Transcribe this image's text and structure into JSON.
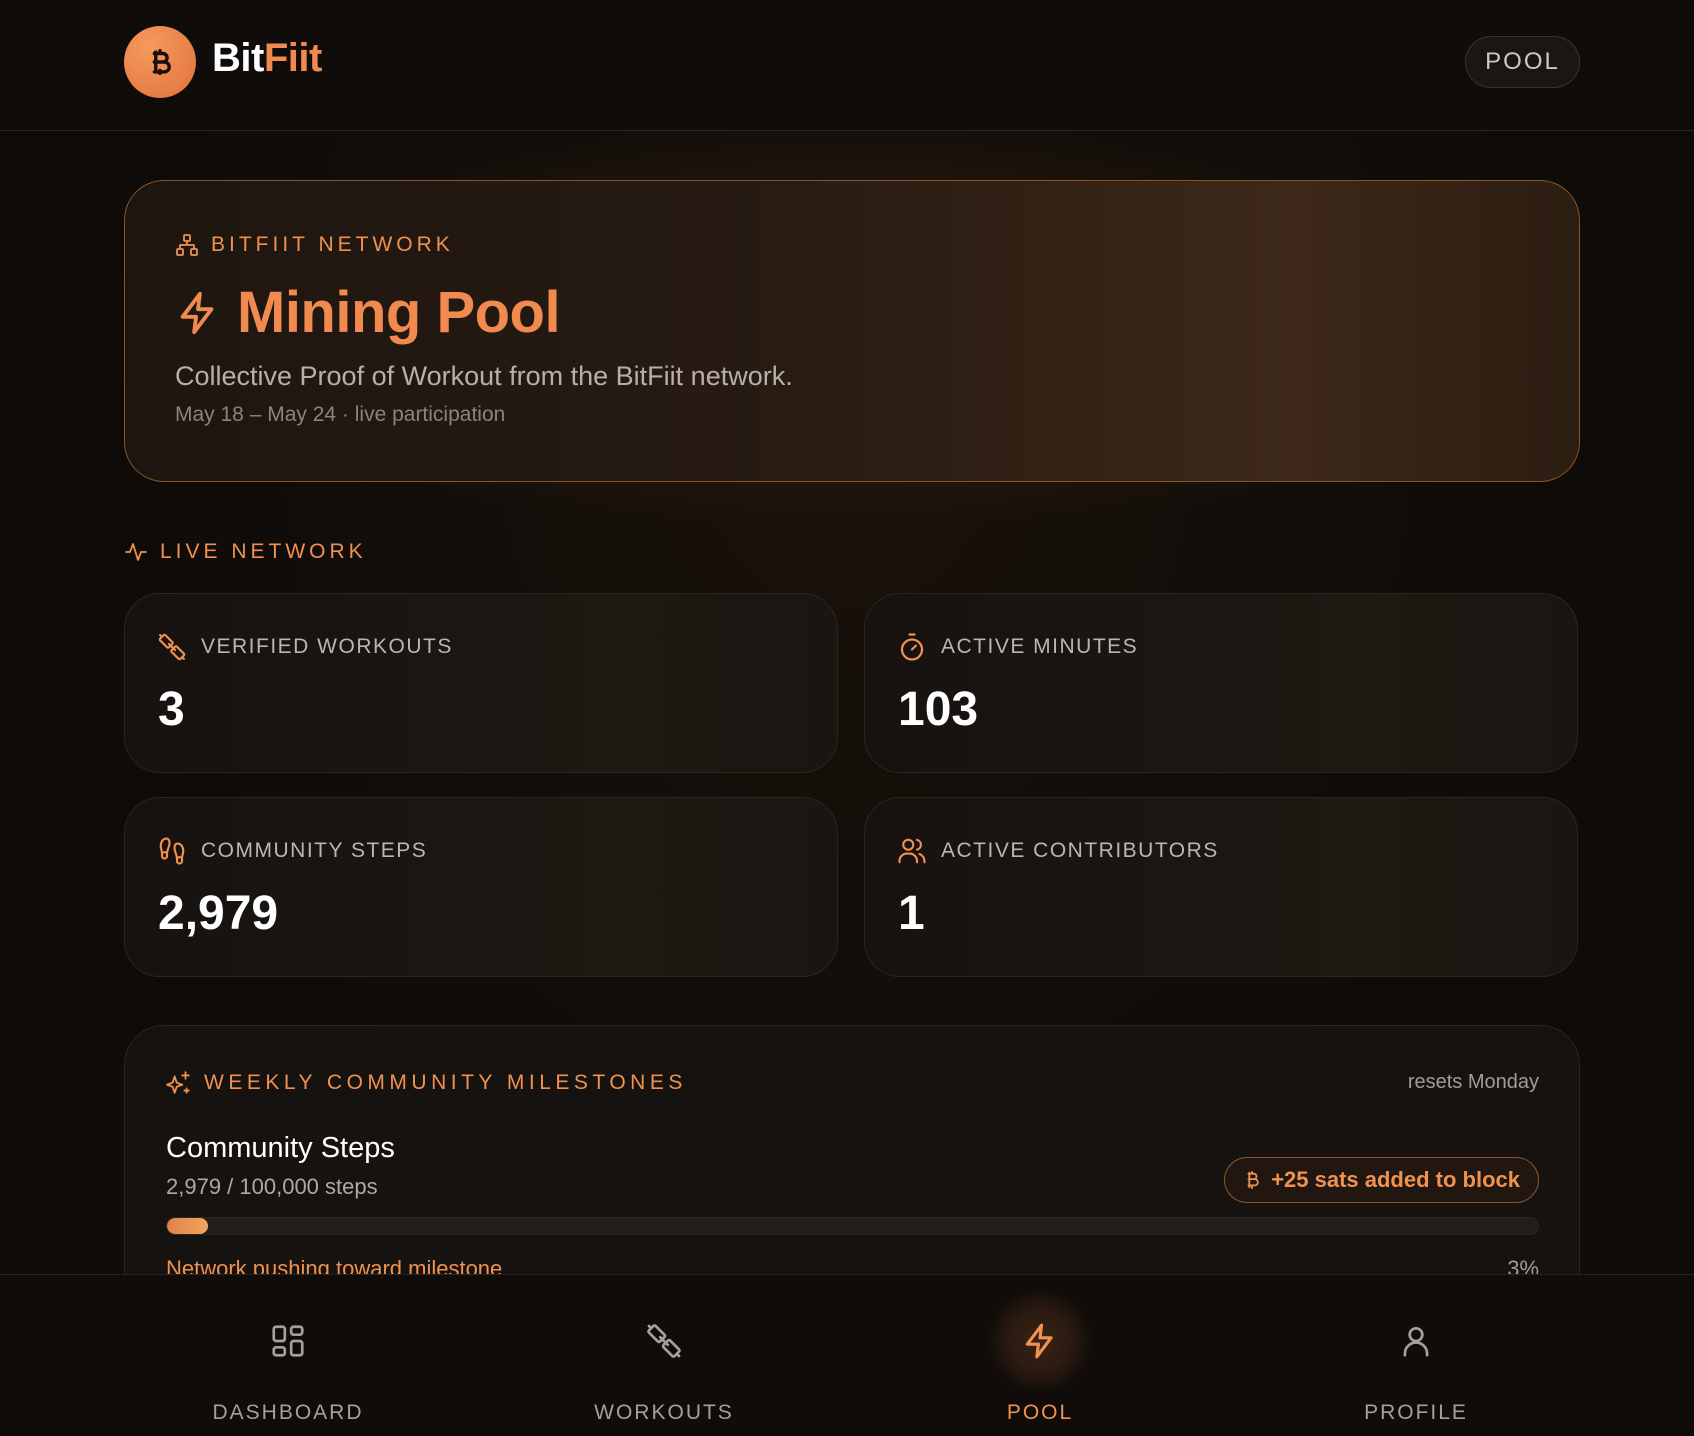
{
  "header": {
    "brand_part1": "Bit",
    "brand_part2": "Fiit",
    "pool_pill": "POOL"
  },
  "hero": {
    "eyebrow": "BITFIIT NETWORK",
    "title": "Mining Pool",
    "subtitle": "Collective Proof of Workout from the BitFiit network.",
    "date_range": "May 18 – May 24 · live participation"
  },
  "live_network": {
    "label": "LIVE NETWORK",
    "stats": [
      {
        "label": "VERIFIED WORKOUTS",
        "value": "3",
        "icon": "dumbbell-icon"
      },
      {
        "label": "ACTIVE MINUTES",
        "value": "103",
        "icon": "timer-icon"
      },
      {
        "label": "COMMUNITY STEPS",
        "value": "2,979",
        "icon": "footprints-icon"
      },
      {
        "label": "ACTIVE CONTRIBUTORS",
        "value": "1",
        "icon": "users-icon"
      }
    ]
  },
  "milestones": {
    "heading": "WEEKLY COMMUNITY MILESTONES",
    "reset_note": "resets Monday",
    "title": "Community Steps",
    "count": "2,979 / 100,000 steps",
    "reward_badge": "+25 sats added to block",
    "progress_percent": 3,
    "note": "Network pushing toward milestone",
    "percent_label": "3%"
  },
  "nav": {
    "items": [
      {
        "label": "DASHBOARD",
        "icon": "dashboard-icon",
        "active": false
      },
      {
        "label": "WORKOUTS",
        "icon": "dumbbell-icon",
        "active": false
      },
      {
        "label": "POOL",
        "icon": "lightning-icon",
        "active": true
      },
      {
        "label": "PROFILE",
        "icon": "user-icon",
        "active": false
      }
    ]
  },
  "colors": {
    "accent": "#f08a4f",
    "background": "#0e0b09",
    "card": "#16120f"
  }
}
